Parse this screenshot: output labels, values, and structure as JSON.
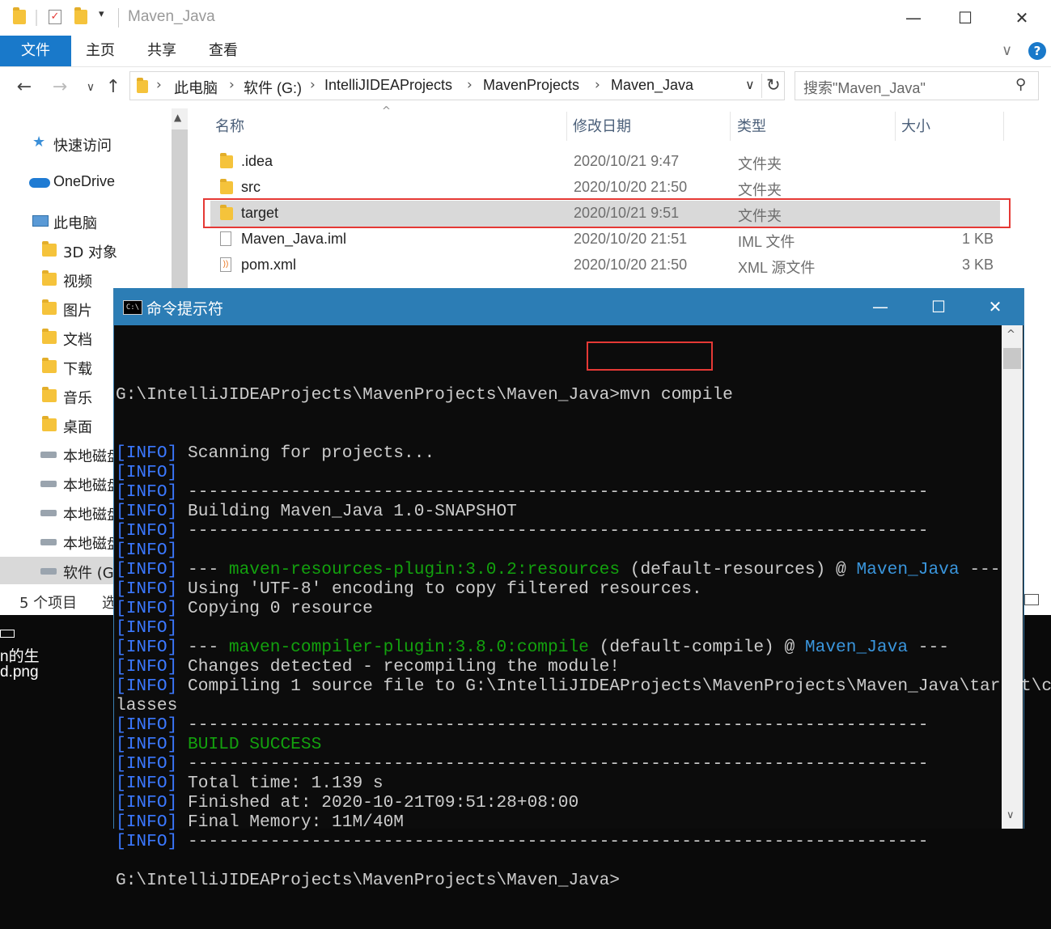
{
  "explorer": {
    "title": "Maven_Java",
    "ribbon_tabs": [
      "文件",
      "主页",
      "共享",
      "查看"
    ],
    "breadcrumb": [
      "此电脑",
      "软件 (G:)",
      "IntelliJIDEAProjects",
      "MavenProjects",
      "Maven_Java"
    ],
    "search_placeholder": "搜索\"Maven_Java\"",
    "nav_items": [
      {
        "label": "快速访问",
        "icon": "star-icon"
      },
      {
        "label": "OneDrive",
        "icon": "cloud-icon"
      },
      {
        "label": "此电脑",
        "icon": "computer-icon"
      },
      {
        "label": "3D 对象",
        "icon": "3d-objects-icon"
      },
      {
        "label": "视频",
        "icon": "video-icon"
      },
      {
        "label": "图片",
        "icon": "pictures-icon"
      },
      {
        "label": "文档",
        "icon": "documents-icon"
      },
      {
        "label": "下载",
        "icon": "download-icon"
      },
      {
        "label": "音乐",
        "icon": "music-icon"
      },
      {
        "label": "桌面",
        "icon": "desktop-icon"
      },
      {
        "label": "本地磁盘",
        "icon": "drive-icon"
      },
      {
        "label": "本地磁盘",
        "icon": "drive-icon"
      },
      {
        "label": "本地磁盘",
        "icon": "drive-icon"
      },
      {
        "label": "本地磁盘",
        "icon": "drive-icon"
      },
      {
        "label": "软件 (G:)",
        "icon": "drive-icon"
      }
    ],
    "columns": {
      "name": "名称",
      "modified": "修改日期",
      "type": "类型",
      "size": "大小"
    },
    "files": [
      {
        "name": ".idea",
        "modified": "2020/10/21 9:47",
        "type": "文件夹",
        "size": "",
        "icon": "folder-icon"
      },
      {
        "name": "src",
        "modified": "2020/10/20 21:50",
        "type": "文件夹",
        "size": "",
        "icon": "folder-icon"
      },
      {
        "name": "target",
        "modified": "2020/10/21 9:51",
        "type": "文件夹",
        "size": "",
        "icon": "folder-icon"
      },
      {
        "name": "Maven_Java.iml",
        "modified": "2020/10/20 21:51",
        "type": "IML 文件",
        "size": "1 KB",
        "icon": "file-icon"
      },
      {
        "name": "pom.xml",
        "modified": "2020/10/20 21:50",
        "type": "XML 源文件",
        "size": "3 KB",
        "icon": "xml-file-icon"
      }
    ],
    "status": {
      "count": "5 个项目",
      "selected": "选"
    }
  },
  "desktop": {
    "labels": [
      "n的生",
      "d.png"
    ]
  },
  "cmd": {
    "title": "命令提示符",
    "prompt": "G:\\IntelliJIDEAProjects\\MavenProjects\\Maven_Java>",
    "command": "mvn compile",
    "tag": "[INFO]",
    "lines": [
      {
        "tag": true,
        "segs": [
          {
            "t": " Scanning for projects...",
            "c": ""
          }
        ]
      },
      {
        "tag": true,
        "segs": []
      },
      {
        "tag": true,
        "segs": [
          {
            "t": " ------------------------------------------------------------------------",
            "c": ""
          }
        ]
      },
      {
        "tag": true,
        "segs": [
          {
            "t": " Building Maven_Java 1.0-SNAPSHOT",
            "c": ""
          }
        ]
      },
      {
        "tag": true,
        "segs": [
          {
            "t": " ------------------------------------------------------------------------",
            "c": ""
          }
        ]
      },
      {
        "tag": true,
        "segs": []
      },
      {
        "tag": true,
        "segs": [
          {
            "t": " --- ",
            "c": ""
          },
          {
            "t": "maven-resources-plugin:3.0.2:resources",
            "c": "grn"
          },
          {
            "t": " (default-resources) @ ",
            "c": ""
          },
          {
            "t": "Maven_Java",
            "c": "cyn"
          },
          {
            "t": " ---",
            "c": ""
          }
        ]
      },
      {
        "tag": true,
        "segs": [
          {
            "t": " Using 'UTF-8' encoding to copy filtered resources.",
            "c": ""
          }
        ]
      },
      {
        "tag": true,
        "segs": [
          {
            "t": " Copying 0 resource",
            "c": ""
          }
        ]
      },
      {
        "tag": true,
        "segs": []
      },
      {
        "tag": true,
        "segs": [
          {
            "t": " --- ",
            "c": ""
          },
          {
            "t": "maven-compiler-plugin:3.8.0:compile",
            "c": "grn"
          },
          {
            "t": " (default-compile) @ ",
            "c": ""
          },
          {
            "t": "Maven_Java",
            "c": "cyn"
          },
          {
            "t": " ---",
            "c": ""
          }
        ]
      },
      {
        "tag": true,
        "segs": [
          {
            "t": " Changes detected - recompiling the module!",
            "c": ""
          }
        ]
      },
      {
        "tag": true,
        "segs": [
          {
            "t": " Compiling 1 source file to G:\\IntelliJIDEAProjects\\MavenProjects\\Maven_Java\\target\\c",
            "c": ""
          }
        ]
      },
      {
        "tag": false,
        "segs": [
          {
            "t": "lasses",
            "c": ""
          }
        ]
      },
      {
        "tag": true,
        "segs": [
          {
            "t": " ------------------------------------------------------------------------",
            "c": ""
          }
        ]
      },
      {
        "tag": true,
        "segs": [
          {
            "t": " ",
            "c": ""
          },
          {
            "t": "BUILD SUCCESS",
            "c": "grn"
          }
        ]
      },
      {
        "tag": true,
        "segs": [
          {
            "t": " ------------------------------------------------------------------------",
            "c": ""
          }
        ]
      },
      {
        "tag": true,
        "segs": [
          {
            "t": " Total time: 1.139 s",
            "c": ""
          }
        ]
      },
      {
        "tag": true,
        "segs": [
          {
            "t": " Finished at: 2020-10-21T09:51:28+08:00",
            "c": ""
          }
        ]
      },
      {
        "tag": true,
        "segs": [
          {
            "t": " Final Memory: 11M/40M",
            "c": ""
          }
        ]
      },
      {
        "tag": true,
        "segs": [
          {
            "t": " ------------------------------------------------------------------------",
            "c": ""
          }
        ]
      },
      {
        "tag": false,
        "segs": []
      }
    ],
    "final_prompt": "G:\\IntelliJIDEAProjects\\MavenProjects\\Maven_Java>"
  },
  "colors": {
    "accent": "#1979ca",
    "cmd_title": "#2c7db5",
    "highlight_box": "#e53935",
    "info_tag": "#3b78ff",
    "success": "#13a10e"
  }
}
